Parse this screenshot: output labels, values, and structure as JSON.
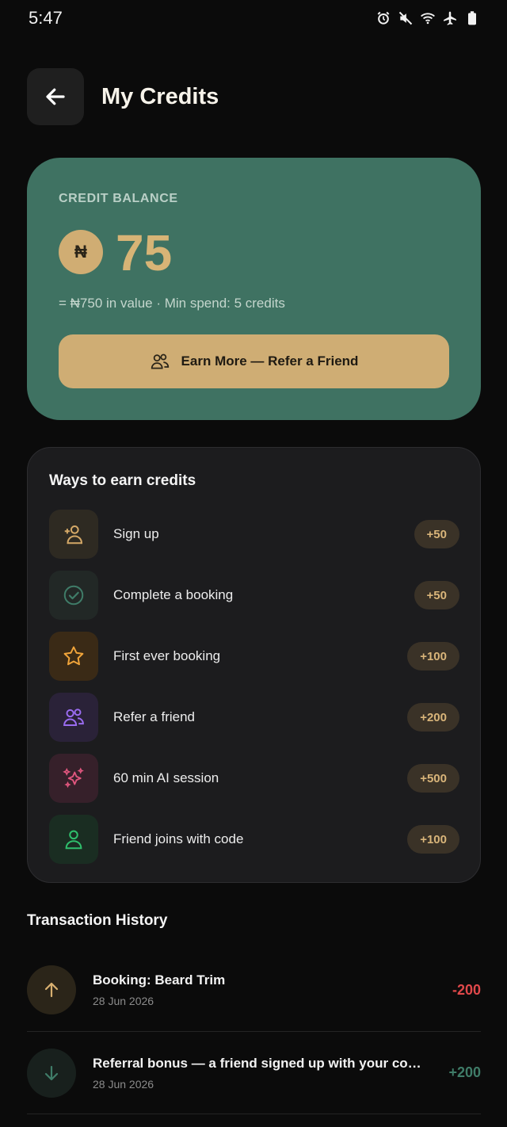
{
  "status_bar": {
    "time": "5:47",
    "icons": [
      "alarm-icon",
      "mute-icon",
      "wifi-icon",
      "airplane-icon",
      "battery-icon"
    ]
  },
  "header": {
    "title": "My Credits",
    "back_icon": "arrow-left-icon"
  },
  "balance": {
    "label": "CREDIT BALANCE",
    "currency_symbol": "₦",
    "amount": "75",
    "subtext": "= ₦750 in value · Min spend: 5 credits",
    "earn_button_label": "Earn More — Refer a Friend",
    "colors": {
      "card": "#3f7262",
      "accent": "#cfad74"
    }
  },
  "ways_to_earn": {
    "title": "Ways to earn credits",
    "items": [
      {
        "label": "Sign up",
        "badge": "+50",
        "icon": "user-plus-icon",
        "color": "#d4a867",
        "bg": "#2e2a22"
      },
      {
        "label": "Complete a booking",
        "badge": "+50",
        "icon": "check-circle-icon",
        "color": "#3f7c68",
        "bg": "#222826"
      },
      {
        "label": "First ever booking",
        "badge": "+100",
        "icon": "star-icon",
        "color": "#f0a43a",
        "bg": "#3a2a16"
      },
      {
        "label": "Refer a friend",
        "badge": "+200",
        "icon": "users-icon",
        "color": "#9a6cf0",
        "bg": "#2a2238"
      },
      {
        "label": "60 min AI session",
        "badge": "+500",
        "icon": "sparkles-icon",
        "color": "#e0567e",
        "bg": "#36202a"
      },
      {
        "label": "Friend joins with code",
        "badge": "+100",
        "icon": "user-icon",
        "color": "#2fbf6c",
        "bg": "#1a2d22"
      }
    ]
  },
  "history": {
    "title": "Transaction History",
    "transactions": [
      {
        "title": "Booking: Beard Trim",
        "date": "28 Jun 2026",
        "amount": "-200",
        "direction": "debit",
        "icon": "arrow-up-icon",
        "amount_color": "#e0484a",
        "icon_color": "#d8b070",
        "icon_bg": "#2b2519"
      },
      {
        "title": "Referral bonus — a friend signed up with your code! ...",
        "date": "28 Jun 2026",
        "amount": "+200",
        "direction": "credit",
        "icon": "arrow-down-icon",
        "amount_color": "#3f7c68",
        "icon_color": "#3f7c68",
        "icon_bg": "#18201d"
      }
    ]
  }
}
